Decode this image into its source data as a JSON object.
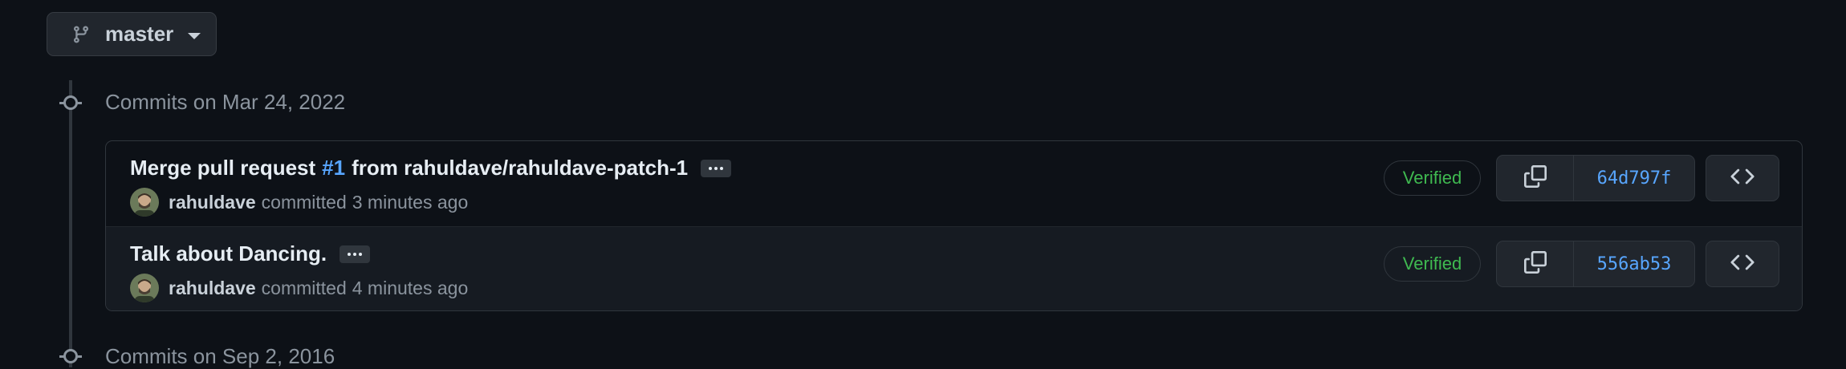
{
  "branch": {
    "name": "master",
    "icon": "git-branch-icon"
  },
  "groups": [
    {
      "heading": "Commits on Mar 24, 2022",
      "commits": [
        {
          "title_prefix": "Merge pull request",
          "pr_ref": "#1",
          "title_suffix": "from rahuldave/rahuldave-patch-1",
          "author": "rahuldave",
          "verb": "committed",
          "time": "3 minutes ago",
          "badge": "Verified",
          "sha": "64d797f"
        },
        {
          "title": "Talk about Dancing.",
          "author": "rahuldave",
          "verb": "committed",
          "time": "4 minutes ago",
          "badge": "Verified",
          "sha": "556ab53"
        }
      ]
    },
    {
      "heading": "Commits on Sep 2, 2016"
    }
  ],
  "colors": {
    "background": "#0d1117",
    "link": "#58a6ff",
    "verified": "#3fb950",
    "muted": "#8b949e"
  }
}
